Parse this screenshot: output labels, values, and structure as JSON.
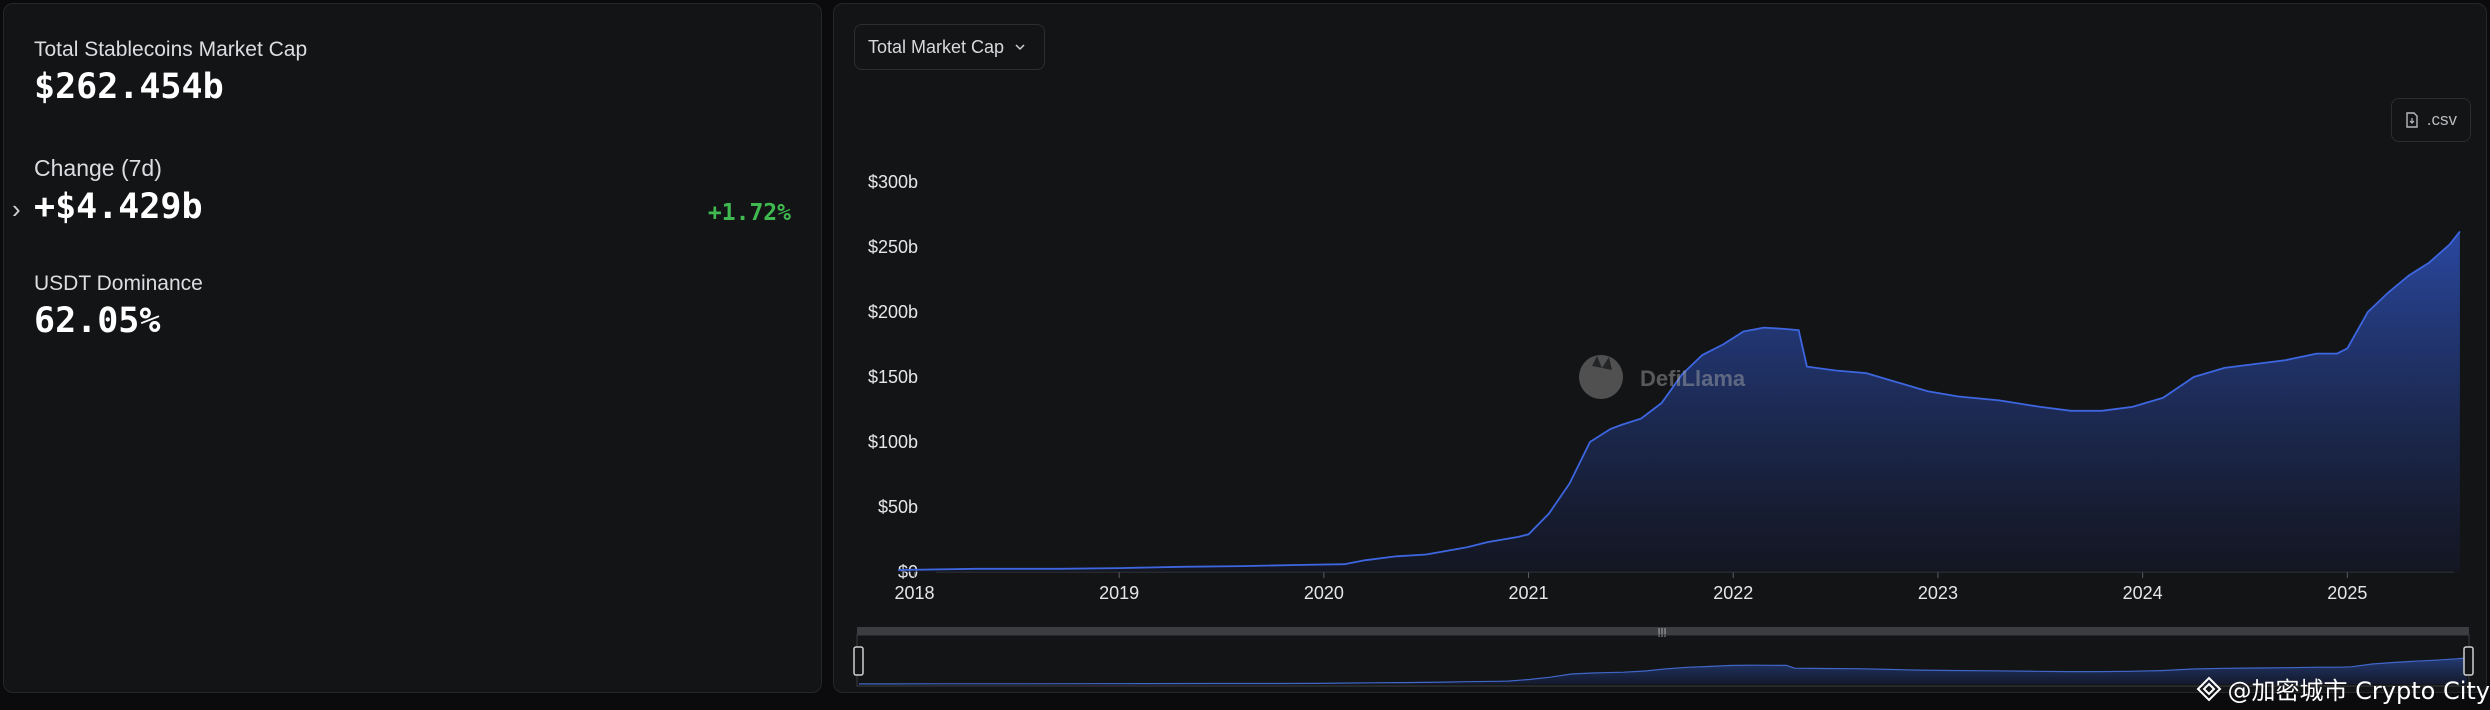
{
  "stats": {
    "market_cap_label": "Total Stablecoins Market Cap",
    "market_cap_value": "$262.454b",
    "change_label": "Change (7d)",
    "change_value": "+$4.429b",
    "change_percent": "+1.72%",
    "dominance_label": "USDT Dominance",
    "dominance_value": "62.05%"
  },
  "controls": {
    "metric_select": "Total Market Cap",
    "csv_label": ".csv"
  },
  "watermark_logo": "DefiLlama",
  "footer_watermark": "@加密城市 Crypto City",
  "colors": {
    "accent": "#2f55c4",
    "positive": "#3fb950",
    "background": "#131416"
  },
  "chart_data": {
    "type": "area",
    "y_ticks": [
      "$0",
      "$50b",
      "$100b",
      "$150b",
      "$200b",
      "$250b",
      "$300b"
    ],
    "x_ticks": [
      "2018",
      "2019",
      "2020",
      "2021",
      "2022",
      "2023",
      "2024",
      "2025"
    ],
    "ylim": [
      0,
      300
    ],
    "xlim": [
      2017.9,
      2025.57
    ],
    "grid": false,
    "series": [
      {
        "x": [
          2017.92,
          2018.3,
          2018.7,
          2019.0,
          2019.3,
          2019.6,
          2019.9,
          2020.1,
          2020.2,
          2020.35,
          2020.5,
          2020.7,
          2020.8,
          2020.95,
          2021.0,
          2021.1,
          2021.2,
          2021.3,
          2021.4,
          2021.45,
          2021.55,
          2021.65,
          2021.75,
          2021.85,
          2021.95,
          2022.05,
          2022.15,
          2022.25,
          2022.32,
          2022.36,
          2022.5,
          2022.65,
          2022.8,
          2022.95,
          2023.1,
          2023.3,
          2023.5,
          2023.65,
          2023.8,
          2023.95,
          2024.1,
          2024.25,
          2024.4,
          2024.55,
          2024.7,
          2024.85,
          2024.95,
          2025.0,
          2025.1,
          2025.2,
          2025.3,
          2025.4,
          2025.5,
          2025.55
        ],
        "y": [
          1.5,
          2.5,
          2.5,
          3,
          4,
          4.5,
          5.5,
          6,
          9,
          12,
          13.5,
          19,
          23,
          27,
          29,
          45,
          68,
          100,
          110,
          113,
          118,
          130,
          152,
          167,
          175,
          185,
          188,
          187,
          186,
          158,
          155,
          153,
          146,
          139,
          135,
          132,
          127,
          124,
          124,
          127,
          134,
          150,
          157,
          160,
          163,
          168,
          168,
          172,
          200,
          215,
          228,
          238,
          252,
          262
        ]
      }
    ]
  }
}
